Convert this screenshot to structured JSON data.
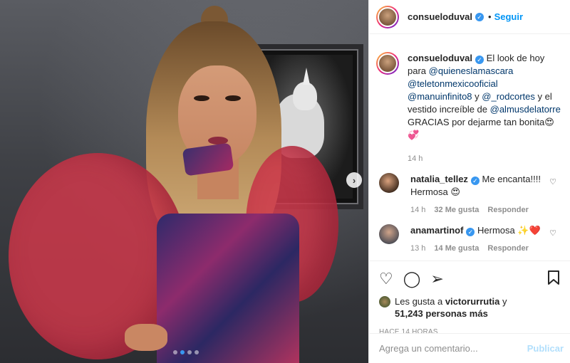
{
  "post": {
    "author": "consueloduval",
    "verified_icon": "verified-badge-icon",
    "follow_label": "Seguir",
    "separator": "•"
  },
  "caption": {
    "username": "consueloduval",
    "line1_text": " El look de hoy para",
    "mention1": "@quieneslamascara",
    "mention2": "@teletonmexicooficial",
    "mention3": "@manuinfinito8",
    "line4_mid": " y ",
    "mention4": "@_rodcortes",
    "line4_end": " y el vestido increíble de ",
    "mention5": "@almusdelatorre",
    "line6": " GRACIAS por dejarme tan bonita😍💞",
    "time": "14 h"
  },
  "comments": [
    {
      "username": "natalia_tellez",
      "text": " Me encanta!!!! Hermosa 😍",
      "time": "14 h",
      "likes": "32 Me gusta",
      "reply": "Responder"
    },
    {
      "username": "anamartinof",
      "text": " Hermosa ✨❤️",
      "time": "13 h",
      "likes": "14 Me gusta",
      "reply": "Responder"
    }
  ],
  "likes": {
    "prefix": "Les gusta a ",
    "user": "victorurrutia",
    "mid": " y ",
    "count": "51,243 personas más"
  },
  "posted_ago": "HACE 14 HORAS",
  "add_comment": {
    "placeholder": "Agrega un comentario...",
    "publish_label": "Publicar"
  },
  "carousel": {
    "total": 4,
    "active": 1
  },
  "colors": {
    "link": "#00376b",
    "accent": "#0095f6",
    "muted": "#8e8e8e"
  }
}
